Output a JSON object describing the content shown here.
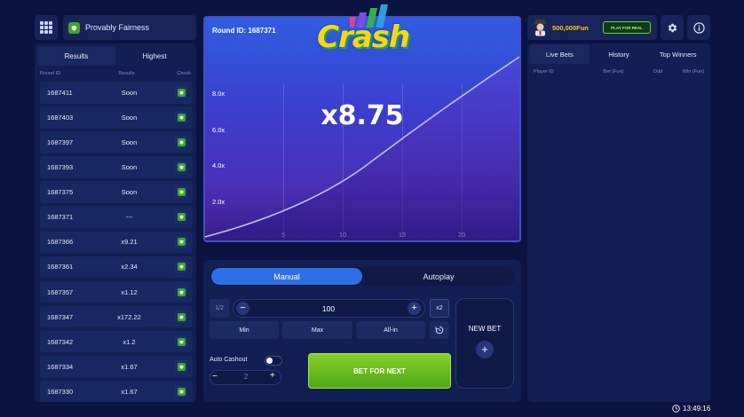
{
  "fairness": {
    "label": "Provably Fairness"
  },
  "left_panel": {
    "tabs": [
      "Results",
      "Highest"
    ],
    "columns": [
      "Round ID",
      "Results",
      "Check"
    ],
    "rows": [
      {
        "id": "1687411",
        "result": "Soon"
      },
      {
        "id": "1687403",
        "result": "Soon"
      },
      {
        "id": "1687397",
        "result": "Soon"
      },
      {
        "id": "1687393",
        "result": "Soon"
      },
      {
        "id": "1687375",
        "result": "Soon"
      },
      {
        "id": "1687371",
        "result": "---"
      },
      {
        "id": "1687366",
        "result": "x9.21"
      },
      {
        "id": "1687361",
        "result": "x2.34"
      },
      {
        "id": "1687357",
        "result": "x1.12"
      },
      {
        "id": "1687347",
        "result": "x172.22"
      },
      {
        "id": "1687342",
        "result": "x1.2"
      },
      {
        "id": "1687334",
        "result": "x1.67"
      },
      {
        "id": "1687330",
        "result": "x1.67"
      }
    ]
  },
  "game": {
    "logo": "Crash",
    "round_label": "Round ID: 1687371",
    "multiplier": "x8.75",
    "y_ticks": [
      "8.0x",
      "6.0x",
      "4.0x",
      "2.0x"
    ],
    "x_ticks": [
      "5",
      "10",
      "15",
      "20"
    ]
  },
  "bet": {
    "modes": [
      "Manual",
      "Autoplay"
    ],
    "half_label": "1/2",
    "amount": "100",
    "double_label": "x2",
    "presets": [
      "Min",
      "Max",
      "All-in"
    ],
    "auto_cashout_label": "Auto Cashout",
    "auto_cashout_value": "2",
    "bet_button": "BET FOR NEXT",
    "new_bet_label": "NEW BET"
  },
  "header": {
    "balance": "500,000Fun",
    "play_real": "PLAY FOR REAL"
  },
  "right_panel": {
    "tabs": [
      "Live Bets",
      "History",
      "Top Winners"
    ],
    "columns": [
      "Player ID",
      "Bet (Fun)",
      "Odd",
      "Win (Fun)"
    ]
  },
  "clock": {
    "time": "13:49:16"
  },
  "colors": {
    "accent_green": "#6bd02a",
    "accent_blue": "#2f6fe4",
    "balance_gold": "#ffc51f"
  }
}
